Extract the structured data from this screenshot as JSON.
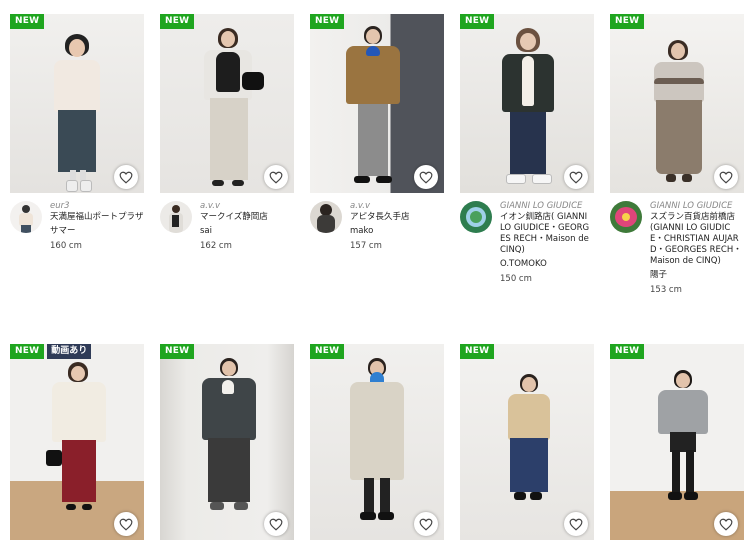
{
  "colors": {
    "new_badge": "#1fa51f",
    "video_badge": "#2f3b57"
  },
  "badges": {
    "new": "NEW",
    "video": "動画あり"
  },
  "icons": {
    "favorite": "heart-outline-icon"
  },
  "row1": [
    {
      "brand": "eur3",
      "shop": "天満屋福山ポートプラザ",
      "staff": "サマー",
      "height": "160 cm"
    },
    {
      "brand": "a.v.v",
      "shop": "マークイズ静岡店",
      "staff": "sai",
      "height": "162 cm"
    },
    {
      "brand": "a.v.v",
      "shop": "アピタ長久手店",
      "staff": "mako",
      "height": "157 cm"
    },
    {
      "brand": "GIANNI LO GIUDICE",
      "shop": "イオン釧路店( GIANNI LO GIUDICE・GEORGES RECH・Maison de CINQ)",
      "staff": "O.TOMOKO",
      "height": "150 cm"
    },
    {
      "brand": "GIANNI LO GIUDICE",
      "shop": "スズラン百貨店前橋店(GIANNI LO GIUDICE・CHRISTIAN AUJARD・GEORGES RECH・Maison de CINQ)",
      "staff": "陽子",
      "height": "153 cm"
    }
  ]
}
